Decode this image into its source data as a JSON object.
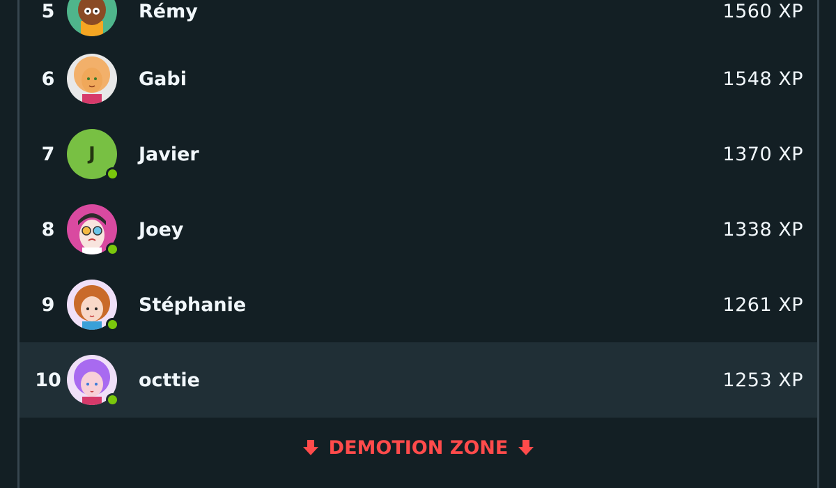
{
  "leaderboard": {
    "rows": [
      {
        "rank": "5",
        "name": "Rémy",
        "xp": "1560 XP",
        "avatar": "remy-avatar",
        "online": false
      },
      {
        "rank": "6",
        "name": "Gabi",
        "xp": "1548 XP",
        "avatar": "gabi-avatar",
        "online": false
      },
      {
        "rank": "7",
        "name": "Javier",
        "initial": "J",
        "xp": "1370 XP",
        "avatar": "initial-avatar",
        "online": true
      },
      {
        "rank": "8",
        "name": "Joey",
        "xp": "1338 XP",
        "avatar": "joey-avatar",
        "online": true
      },
      {
        "rank": "9",
        "name": "Stéphanie",
        "xp": "1261 XP",
        "avatar": "stephanie-avatar",
        "online": true
      },
      {
        "rank": "10",
        "name": "octtie",
        "xp": "1253 XP",
        "avatar": "octtie-avatar",
        "online": true,
        "current_user": true
      }
    ]
  },
  "demotion": {
    "label": "DEMOTION ZONE",
    "color": "#ff4b4b",
    "icon": "arrow-down-icon"
  },
  "colors": {
    "background": "#131f24",
    "highlight_row": "#202f36",
    "online": "#7ac70c",
    "initial_avatar": "#78c043"
  }
}
